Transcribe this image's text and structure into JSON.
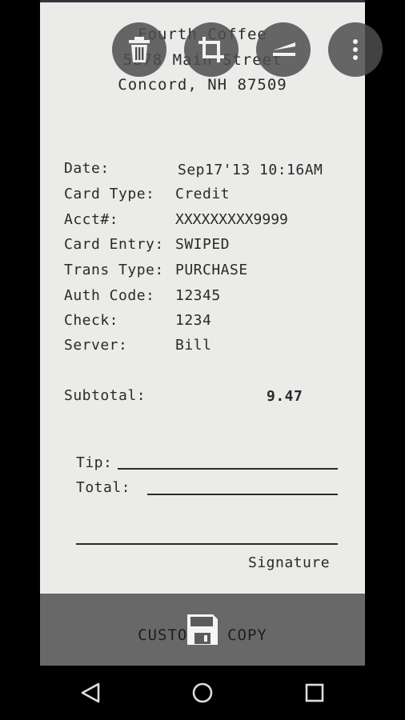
{
  "receipt": {
    "header": [
      "Fourth Coffee",
      "5678 Main Street",
      "Concord, NH 87509"
    ],
    "fields": [
      {
        "label": "Date:",
        "value": "Sep17'13 10:16AM"
      },
      {
        "label": "Card Type:",
        "value": "Credit"
      },
      {
        "label": "Acct#:",
        "value": "XXXXXXXXX9999"
      },
      {
        "label": "Card Entry:",
        "value": "SWIPED"
      },
      {
        "label": "Trans Type:",
        "value": "PURCHASE"
      },
      {
        "label": "Auth Code:",
        "value": "12345"
      },
      {
        "label": "Check:",
        "value": "1234"
      },
      {
        "label": "Server:",
        "value": "Bill"
      }
    ],
    "subtotal_label": "Subtotal:",
    "subtotal_value": "9.47",
    "tip_label": "Tip:",
    "total_label": "Total:",
    "signature_label": "Signature",
    "footer": "CUSTOMER COPY"
  },
  "toolbar": {
    "delete_icon": "trash-icon",
    "crop_icon": "crop-icon",
    "filter_icon": "filter-icon",
    "more_icon": "more-vert-icon"
  },
  "bottom": {
    "save_icon": "floppy-disk-icon"
  },
  "navbar": {
    "back_icon": "triangle-back-icon",
    "home_icon": "circle-home-icon",
    "recents_icon": "square-recents-icon"
  },
  "colors": {
    "paper": "#ebebe9",
    "ink": "#2a2a2a",
    "fab": "#4e4e4e",
    "panel": "#5c5c5c"
  }
}
